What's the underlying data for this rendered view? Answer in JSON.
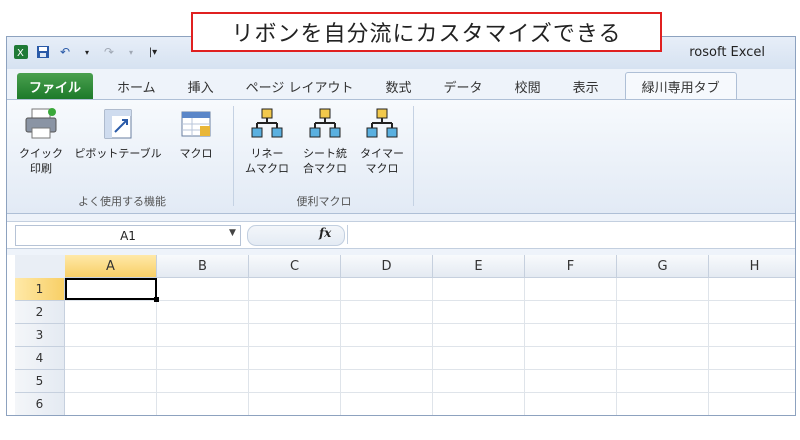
{
  "callout": {
    "text": "リボンを自分流にカスタマイズできる"
  },
  "titlebar": {
    "app_title": "rosoft Excel"
  },
  "tabs": [
    {
      "label": "ファイル",
      "kind": "file"
    },
    {
      "label": "ホーム"
    },
    {
      "label": "挿入"
    },
    {
      "label": "ページ レイアウト"
    },
    {
      "label": "数式"
    },
    {
      "label": "データ"
    },
    {
      "label": "校閲"
    },
    {
      "label": "表示"
    },
    {
      "label": "緑川専用タブ",
      "active": true
    }
  ],
  "ribbon": {
    "groups": [
      {
        "label": "よく使用する機能",
        "buttons": [
          {
            "line1": "クイック",
            "line2": "印刷",
            "icon": "printer-icon"
          },
          {
            "line1": "ピボットテーブル",
            "line2": "",
            "icon": "pivot-table-icon"
          },
          {
            "line1": "マクロ",
            "line2": "",
            "icon": "macro-icon"
          }
        ]
      },
      {
        "label": "便利マクロ",
        "buttons": [
          {
            "line1": "リネー",
            "line2": "ムマクロ",
            "icon": "hierarchy-icon"
          },
          {
            "line1": "シート統",
            "line2": "合マクロ",
            "icon": "hierarchy-icon"
          },
          {
            "line1": "タイマー",
            "line2": "マクロ",
            "icon": "hierarchy-icon"
          }
        ]
      }
    ]
  },
  "formula_bar": {
    "name_box": "A1",
    "fx": "fx"
  },
  "grid": {
    "columns": [
      "A",
      "B",
      "C",
      "D",
      "E",
      "F",
      "G",
      "H"
    ],
    "rows": [
      "1",
      "2",
      "3",
      "4",
      "5",
      "6"
    ],
    "selected_column": "A",
    "selected_row": "1"
  },
  "colors": {
    "file_tab": "#1d7a2a",
    "callout_border": "#e02020",
    "header_selected": "#f8cf66"
  }
}
